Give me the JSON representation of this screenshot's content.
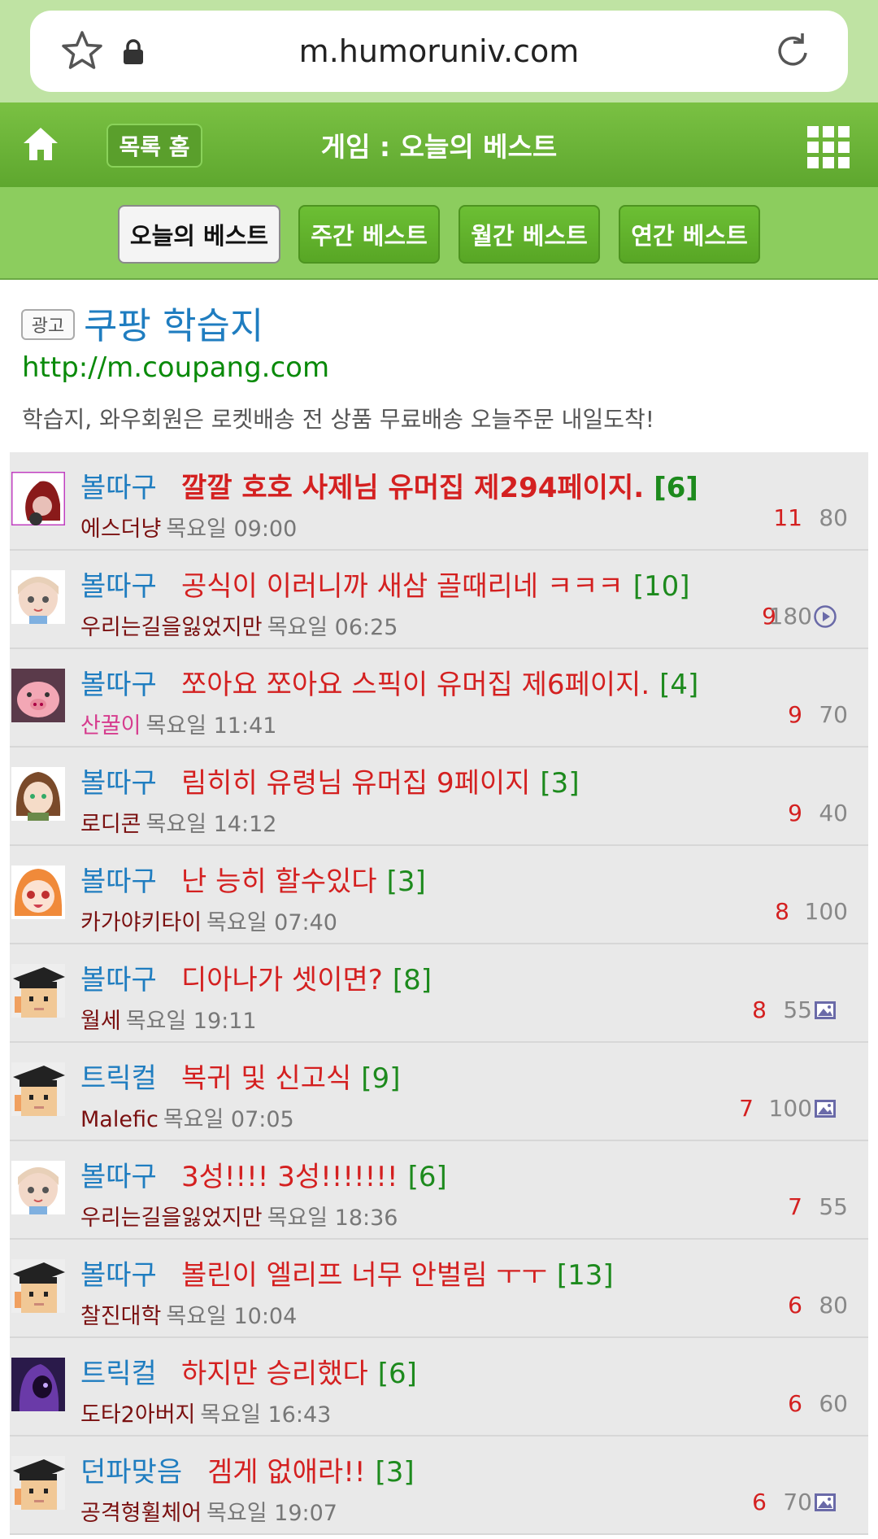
{
  "browser": {
    "url": "m.humoruniv.com"
  },
  "header": {
    "list_home": "목록 홈",
    "title": "게임 : 오늘의 베스트"
  },
  "tabs": [
    "오늘의 베스트",
    "주간 베스트",
    "월간 베스트",
    "연간 베스트"
  ],
  "ad": {
    "tag": "광고",
    "title": "쿠팡 학습지",
    "url": "http://m.coupang.com",
    "desc": "학습지, 와우회원은 로켓배송 전 상품 무료배송 오늘주문 내일도착!"
  },
  "posts": [
    {
      "category": "볼따구",
      "title": "깔깔 호호 사제님 유머집 제294페이지.",
      "comments": "[6]",
      "author": "에스더냥",
      "time": "목요일 09:00",
      "recommend": "11",
      "views": "80",
      "icon": "none",
      "avatar": "redhood-avatar"
    },
    {
      "category": "볼따구",
      "title": "공식이 이러니까 새삼 골때리네 ㅋㅋㅋ",
      "comments": "[10]",
      "author": "우리는길을잃었지만",
      "time": "목요일 06:25",
      "recommend": "9",
      "views": "180",
      "icon": "play-icon",
      "avatar": "anime-girl-avatar"
    },
    {
      "category": "볼따구",
      "title": "쪼아요 쪼아요 스픽이 유머집 제6페이지.",
      "comments": "[4]",
      "author": "산꿀이",
      "time": "목요일 11:41",
      "recommend": "9",
      "views": "70",
      "icon": "none",
      "avatar": "pig-avatar"
    },
    {
      "category": "볼따구",
      "title": "림히히 유령님 유머집 9페이지",
      "comments": "[3]",
      "author": "로디콘",
      "time": "목요일 14:12",
      "recommend": "9",
      "views": "40",
      "icon": "none",
      "avatar": "brown-hair-avatar"
    },
    {
      "category": "볼따구",
      "title": "난 능히 할수있다",
      "comments": "[3]",
      "author": "카가야키타이",
      "time": "목요일 07:40",
      "recommend": "8",
      "views": "100",
      "icon": "none",
      "avatar": "orange-hair-avatar"
    },
    {
      "category": "볼따구",
      "title": "디아나가 셋이면?",
      "comments": "[8]",
      "author": "월세",
      "time": "목요일 19:11",
      "recommend": "8",
      "views": "55",
      "icon": "image-icon",
      "avatar": "graduate-avatar"
    },
    {
      "category": "트릭컬",
      "title": "복귀 및 신고식",
      "comments": "[9]",
      "author": "Malefic",
      "time": "목요일 07:05",
      "recommend": "7",
      "views": "100",
      "icon": "image-icon",
      "avatar": "graduate-avatar"
    },
    {
      "category": "볼따구",
      "title": "3성!!!! 3성!!!!!!!",
      "comments": "[6]",
      "author": "우리는길을잃었지만",
      "time": "목요일 18:36",
      "recommend": "7",
      "views": "55",
      "icon": "none",
      "avatar": "anime-girl-avatar"
    },
    {
      "category": "볼따구",
      "title": "볼린이 엘리프 너무 안벌림 ㅜㅜ",
      "comments": "[13]",
      "author": "찰진대학",
      "time": "목요일 10:04",
      "recommend": "6",
      "views": "80",
      "icon": "none",
      "avatar": "graduate-avatar"
    },
    {
      "category": "트릭컬",
      "title": "하지만 승리했다",
      "comments": "[6]",
      "author": "도타2아버지",
      "time": "목요일 16:43",
      "recommend": "6",
      "views": "60",
      "icon": "none",
      "avatar": "purple-hood-avatar"
    },
    {
      "category": "던파맞음",
      "title": "겜게 없애라!!",
      "comments": "[3]",
      "author": "공격형휠체어",
      "time": "목요일 19:07",
      "recommend": "6",
      "views": "70",
      "icon": "image-icon",
      "avatar": "graduate-avatar"
    }
  ]
}
